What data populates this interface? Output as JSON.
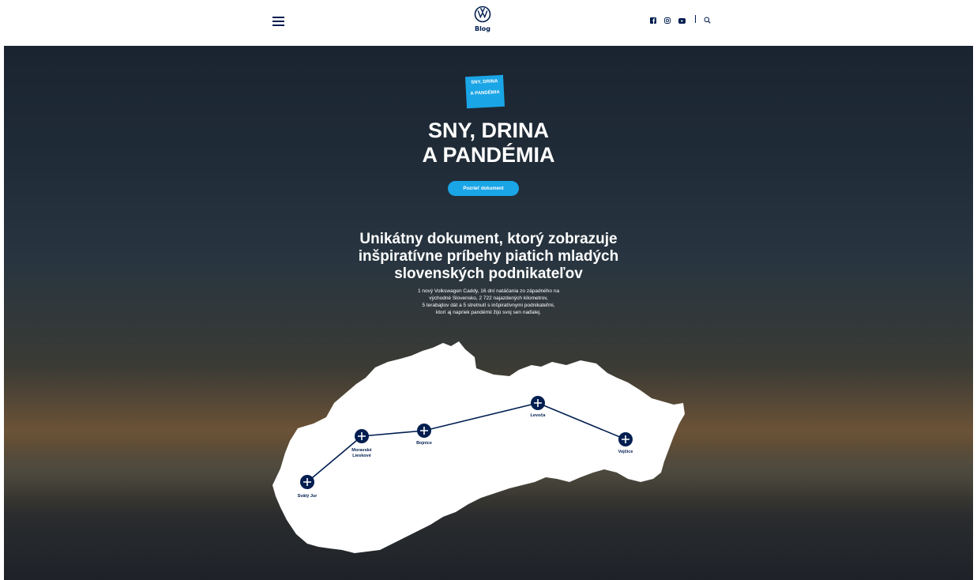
{
  "header": {
    "logo_text": "Blog",
    "social": [
      "facebook-icon",
      "instagram-icon",
      "youtube-icon",
      "search-icon"
    ]
  },
  "hero": {
    "badge_line1": "SNY, DRINA",
    "badge_line2": "A PANDÉMIA",
    "title_line1": "SNY, DRINA",
    "title_line2": "A PANDÉMIA",
    "cta_label": "Pozrieť dokument",
    "subtitle_line1": "Unikátny dokument, ktorý zobrazuje",
    "subtitle_line2": "inšpiratívne príbehy piatich mladých",
    "subtitle_line3": "slovenských podnikateľov",
    "desc_line1": "1 nový Volkswagen Caddy, 16 dní natáčania zo západného na",
    "desc_line2": "východné Slovensko, 2 722 najazdených kilometrov,",
    "desc_line3": "5 terabajtov dát a 5 stretnutí s inšpiratívnymi podnikateľmi,",
    "desc_line4": "ktorí aj napriek pandémii žijú svoj sen naďalej."
  },
  "map": {
    "markers": [
      {
        "label_line1": "Svätý Jur",
        "label_line2": ""
      },
      {
        "label_line1": "Moravské",
        "label_line2": "Lieskové"
      },
      {
        "label_line1": "Bojnice",
        "label_line2": ""
      },
      {
        "label_line1": "Levoča",
        "label_line2": ""
      },
      {
        "label_line1": "Vojčice",
        "label_line2": ""
      }
    ]
  },
  "colors": {
    "navy": "#001e50",
    "accent": "#1aa5e6"
  }
}
